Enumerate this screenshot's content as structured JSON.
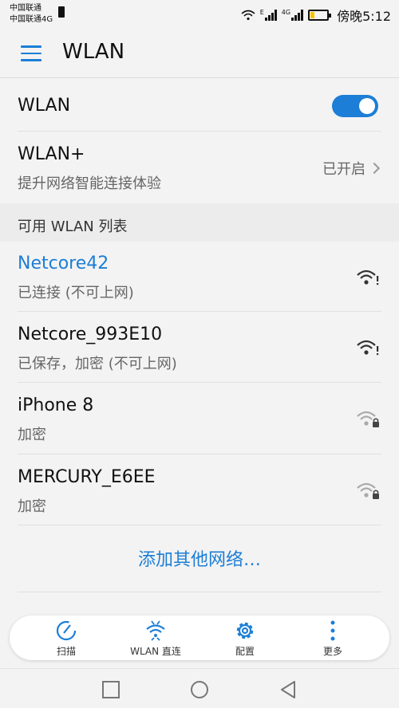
{
  "status_bar": {
    "carrier_1": "中国联通",
    "carrier_2": "中国联通4G",
    "signal_1_label": "E",
    "signal_2_label": "4G",
    "time": "傍晚5:12"
  },
  "header": {
    "title": "WLAN"
  },
  "wlan_toggle": {
    "label": "WLAN",
    "enabled": true
  },
  "wlan_plus": {
    "label": "WLAN+",
    "description": "提升网络智能连接体验",
    "status": "已开启"
  },
  "section": {
    "title": "可用 WLAN 列表"
  },
  "networks": [
    {
      "name": "Netcore42",
      "status": "已连接 (不可上网)",
      "connected": true,
      "icon": "wifi-warning-icon"
    },
    {
      "name": "Netcore_993E10",
      "status": "已保存，加密 (不可上网)",
      "connected": false,
      "icon": "wifi-warning-icon"
    },
    {
      "name": "iPhone  8",
      "status": "加密",
      "connected": false,
      "icon": "wifi-lock-icon"
    },
    {
      "name": "MERCURY_E6EE",
      "status": "加密",
      "connected": false,
      "icon": "wifi-lock-icon"
    }
  ],
  "add_network": {
    "label": "添加其他网络…"
  },
  "actions": [
    {
      "label": "扫描",
      "icon": "scan-icon"
    },
    {
      "label": "WLAN 直连",
      "icon": "wifi-direct-icon"
    },
    {
      "label": "配置",
      "icon": "gear-icon"
    },
    {
      "label": "更多",
      "icon": "more-vertical-icon"
    }
  ],
  "nav": {
    "icons": [
      "recents-square-icon",
      "home-circle-icon",
      "back-triangle-icon"
    ]
  },
  "colors": {
    "accent": "#1c7ed6",
    "background": "#f3f3f3",
    "section_bg": "#ececec"
  }
}
